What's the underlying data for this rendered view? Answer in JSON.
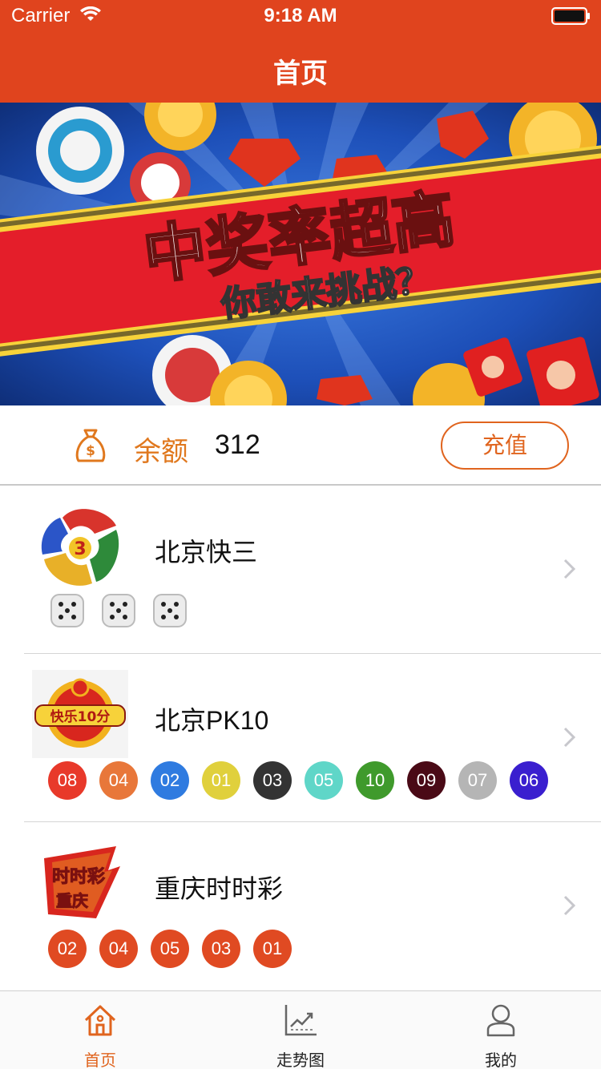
{
  "status_bar": {
    "carrier": "Carrier",
    "time": "9:18 AM"
  },
  "nav": {
    "title": "首页"
  },
  "banner": {
    "headline": "中奖率超高",
    "subline": "你敢来挑战？"
  },
  "balance": {
    "label": "余额",
    "value": "312",
    "recharge_label": "充值"
  },
  "games": [
    {
      "name": "北京快三",
      "logo": "k3-logo-icon",
      "dice": [
        "dice-icon",
        "dice-icon",
        "dice-icon"
      ]
    },
    {
      "name": "北京PK10",
      "logo": "kuaile-10fen-logo-icon",
      "balls": [
        {
          "num": "08",
          "color": "#e8392a"
        },
        {
          "num": "04",
          "color": "#e8773a"
        },
        {
          "num": "02",
          "color": "#2f7be0"
        },
        {
          "num": "01",
          "color": "#e0d03c"
        },
        {
          "num": "03",
          "color": "#333333"
        },
        {
          "num": "05",
          "color": "#5fd6c8"
        },
        {
          "num": "10",
          "color": "#3f9a2c"
        },
        {
          "num": "09",
          "color": "#4a0a16"
        },
        {
          "num": "07",
          "color": "#b5b5b5"
        },
        {
          "num": "06",
          "color": "#3a1fcf"
        }
      ]
    },
    {
      "name": "重庆时时彩",
      "logo": "shishicai-logo-icon",
      "balls": [
        {
          "num": "02",
          "color": "#e04a22"
        },
        {
          "num": "04",
          "color": "#e04a22"
        },
        {
          "num": "05",
          "color": "#e04a22"
        },
        {
          "num": "03",
          "color": "#e04a22"
        },
        {
          "num": "01",
          "color": "#e04a22"
        }
      ]
    }
  ],
  "tabs": [
    {
      "label": "首页",
      "icon": "home-icon",
      "active": true
    },
    {
      "label": "走势图",
      "icon": "trend-chart-icon",
      "active": false
    },
    {
      "label": "我的",
      "icon": "user-icon",
      "active": false
    }
  ],
  "colors": {
    "primary": "#e0441e",
    "accent": "#e0641e",
    "label_orange": "#e0781e"
  }
}
